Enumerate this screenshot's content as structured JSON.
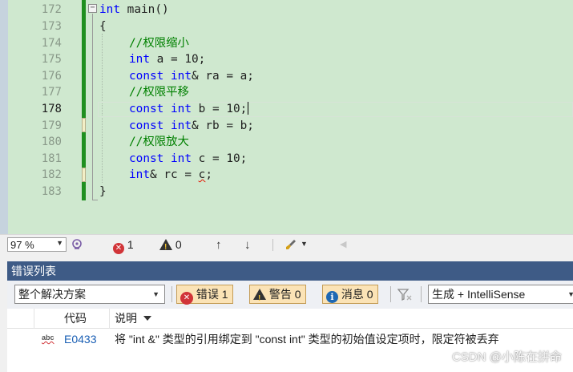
{
  "editor": {
    "line_numbers": [
      "172",
      "173",
      "174",
      "175",
      "176",
      "177",
      "178",
      "179",
      "180",
      "181",
      "182",
      "183"
    ],
    "current_line": "178",
    "code": {
      "l172_kw": "int",
      "l172_rest": " main()",
      "l173": "{",
      "l174_comment": "//权限缩小",
      "l175_kw": "int",
      "l175_rest": " a = 10;",
      "l176_kw1": "const",
      "l176_kw2": "int",
      "l176_rest": "& ra = a;",
      "l177_comment": "//权限平移",
      "l178_kw1": "const",
      "l178_kw2": "int",
      "l178_rest": " b = 10;",
      "l179_kw1": "const",
      "l179_kw2": "int",
      "l179_rest": "& rb = b;",
      "l180_comment": "//权限放大",
      "l181_kw1": "const",
      "l181_kw2": "int",
      "l181_rest": " c = 10;",
      "l182_kw": "int",
      "l182_mid": "& rc = ",
      "l182_err": "c",
      "l182_end": ";",
      "l183": "}"
    },
    "fold_glyph": "−"
  },
  "edit_strip": {
    "zoom": "97 %",
    "error_count": "1",
    "warning_count": "0",
    "up_arrow": "↑",
    "down_arrow": "↓"
  },
  "error_list": {
    "title": "错误列表",
    "scope": "整个解决方案",
    "errors_btn": "错误 1",
    "warnings_btn": "警告 0",
    "messages_btn": "消息 0",
    "build_source": "生成 + IntelliSense",
    "columns": {
      "code": "代码",
      "description": "说明"
    },
    "rows": [
      {
        "code": "E0433",
        "description": "将 \"int &\" 类型的引用绑定到 \"const int\" 类型的初始值设定项时，限定符被丢弃"
      }
    ]
  },
  "watermark": "CSDN @⁦⁦小陈在拼命⁦⁦",
  "colors": {
    "editor_bg": "#cfe8cf",
    "keyword": "#0000ff",
    "comment": "#008000",
    "panel_title": "#3e5b86",
    "error_red": "#d13438",
    "link_blue": "#1a5fb4"
  },
  "icons": [
    "fold-minus-icon",
    "intellicode-icon",
    "error-icon",
    "warning-icon",
    "up-arrow-icon",
    "down-arrow-icon",
    "brush-icon",
    "filter-icon",
    "info-icon",
    "spell-check-icon"
  ]
}
